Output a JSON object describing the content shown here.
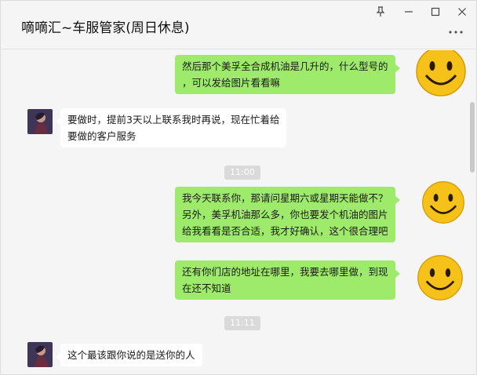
{
  "window": {
    "title": "嘀嘀汇~车服管家(周日休息)"
  },
  "messages": [
    {
      "lines": [
        "然后那个美孚全合成机油是几升的，什么型号的",
        "，可以发给图片看看嘛"
      ]
    },
    {
      "lines": [
        "要做时，提前3天以上联系我时再说，现在忙着给",
        "要做的客户服务"
      ]
    },
    {
      "time": "11:00"
    },
    {
      "lines": [
        "我今天联系你，那请问星期六或星期天能做不？",
        "另外，美孚机油那么多，你也要发个机油的图片",
        "给我看看是否合适，我才好确认，这个很合理吧"
      ]
    },
    {
      "lines": [
        "还有你们店的地址在哪里，我要去哪里做，到现",
        "在还不知道"
      ]
    },
    {
      "time": "11:11"
    },
    {
      "lines": [
        "这个最该跟你说的是送你的人"
      ]
    }
  ],
  "colors": {
    "outgoing_bubble": "#9eea6a",
    "incoming_bubble": "#ffffff",
    "background": "#f5f5f5",
    "timestamp_bg": "#dadada"
  }
}
